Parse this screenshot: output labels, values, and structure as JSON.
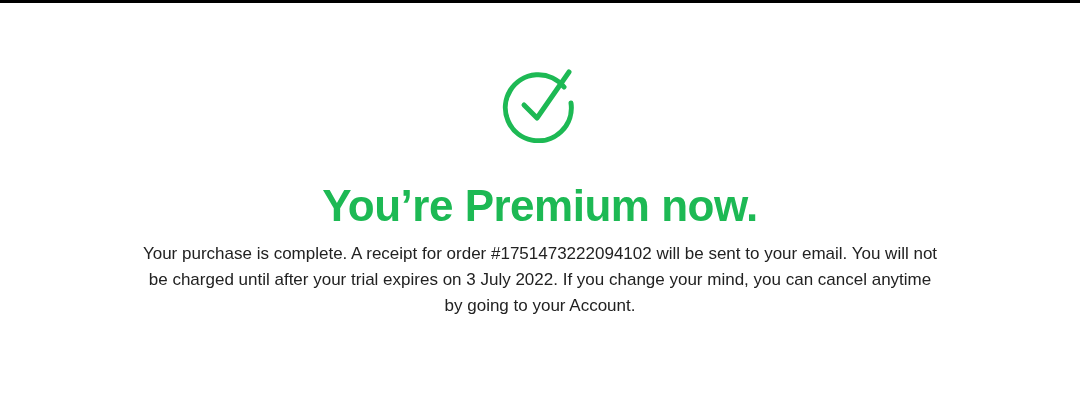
{
  "heading": "You’re Premium now.",
  "message": "Your purchase is complete. A receipt for order #1751473222094102 will be sent to your email. You will not be charged until after your trial expires on 3 July 2022. If you change your mind, you can cancel anytime by going to your Account."
}
